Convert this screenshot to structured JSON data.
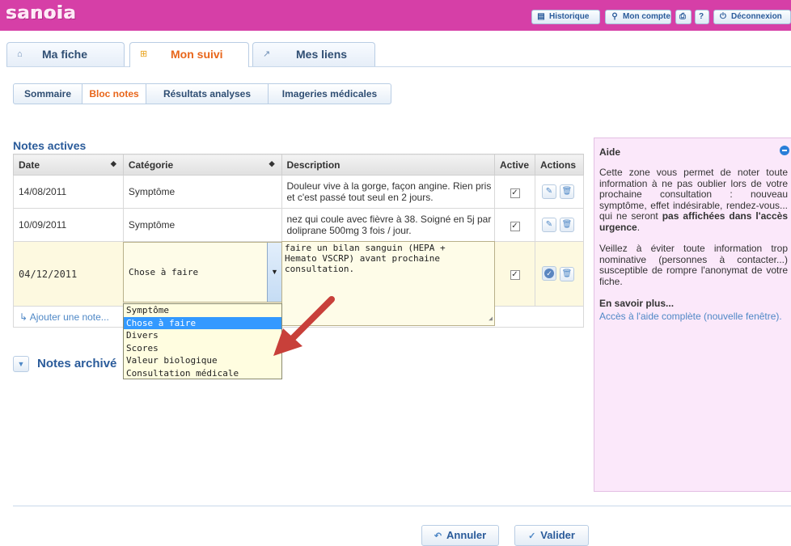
{
  "header": {
    "logo": "sanoia",
    "buttons": [
      {
        "label": "Historique",
        "icon": "history-icon"
      },
      {
        "label": "Mon compte",
        "icon": "user-icon"
      },
      {
        "label": "",
        "icon": "print-icon"
      },
      {
        "label": "?",
        "icon": "help-icon"
      },
      {
        "label": "Déconnexion",
        "icon": "power-icon"
      }
    ]
  },
  "tabs": [
    {
      "label": "Ma fiche",
      "icon": "home-icon",
      "active": false
    },
    {
      "label": "Mon suivi",
      "icon": "follow-up-icon",
      "active": true
    },
    {
      "label": "Mes liens",
      "icon": "external-link-icon",
      "active": false
    }
  ],
  "subtabs": [
    {
      "label": "Sommaire",
      "active": false
    },
    {
      "label": "Bloc notes",
      "active": true
    },
    {
      "label": "Résultats analyses",
      "active": false
    },
    {
      "label": "Imageries médicales",
      "active": false
    }
  ],
  "notes": {
    "title": "Notes actives",
    "columns": [
      "Date",
      "Catégorie",
      "Description",
      "Active",
      "Actions"
    ],
    "rows": [
      {
        "date": "14/08/2011",
        "category": "Symptôme",
        "description": "Douleur vive à la gorge, façon angine. Rien pris et c'est passé tout seul en 2 jours.",
        "active": true
      },
      {
        "date": "10/09/2011",
        "category": "Symptôme",
        "description": "nez qui coule avec fièvre à 38. Soigné en 5j par doliprane 500mg 3 fois / jour.",
        "active": true
      }
    ],
    "edit_row": {
      "date": "04/12/2011",
      "category": "Chose à faire",
      "description": "faire un bilan sanguin (HEPA +\nHemato VSCRP) avant prochaine\nconsultation.",
      "active": true
    },
    "category_options": [
      "Symptôme",
      "Chose à faire",
      "Divers",
      "Scores",
      "Valeur biologique",
      "Consultation médicale"
    ],
    "selected_option": "Chose à faire",
    "add_label": "Ajouter une note..."
  },
  "archived": {
    "label": "Notes archivé"
  },
  "aide": {
    "title": "Aide",
    "p1_start": "Cette zone vous permet de noter toute information à ne pas oublier lors de votre prochaine consultation : nouveau symptôme, effet indésirable, rendez-vous... qui ne seront ",
    "p1_bold": "pas affichées dans l'accès urgence",
    "p1_end": ".",
    "p2": "Veillez à éviter toute information trop nominative (personnes à contacter...) susceptible de rompre l'anonymat de votre fiche.",
    "more_title": "En savoir plus...",
    "more_link": "Accès à l'aide complète (nouvelle fenêtre)."
  },
  "footer": {
    "cancel": "Annuler",
    "validate": "Valider"
  },
  "colors": {
    "brand": "#d63fa7",
    "accent_orange": "#e8661b",
    "link_blue": "#4f88c6",
    "selection": "#3399ff",
    "annotation_arrow": "#c8403a"
  }
}
